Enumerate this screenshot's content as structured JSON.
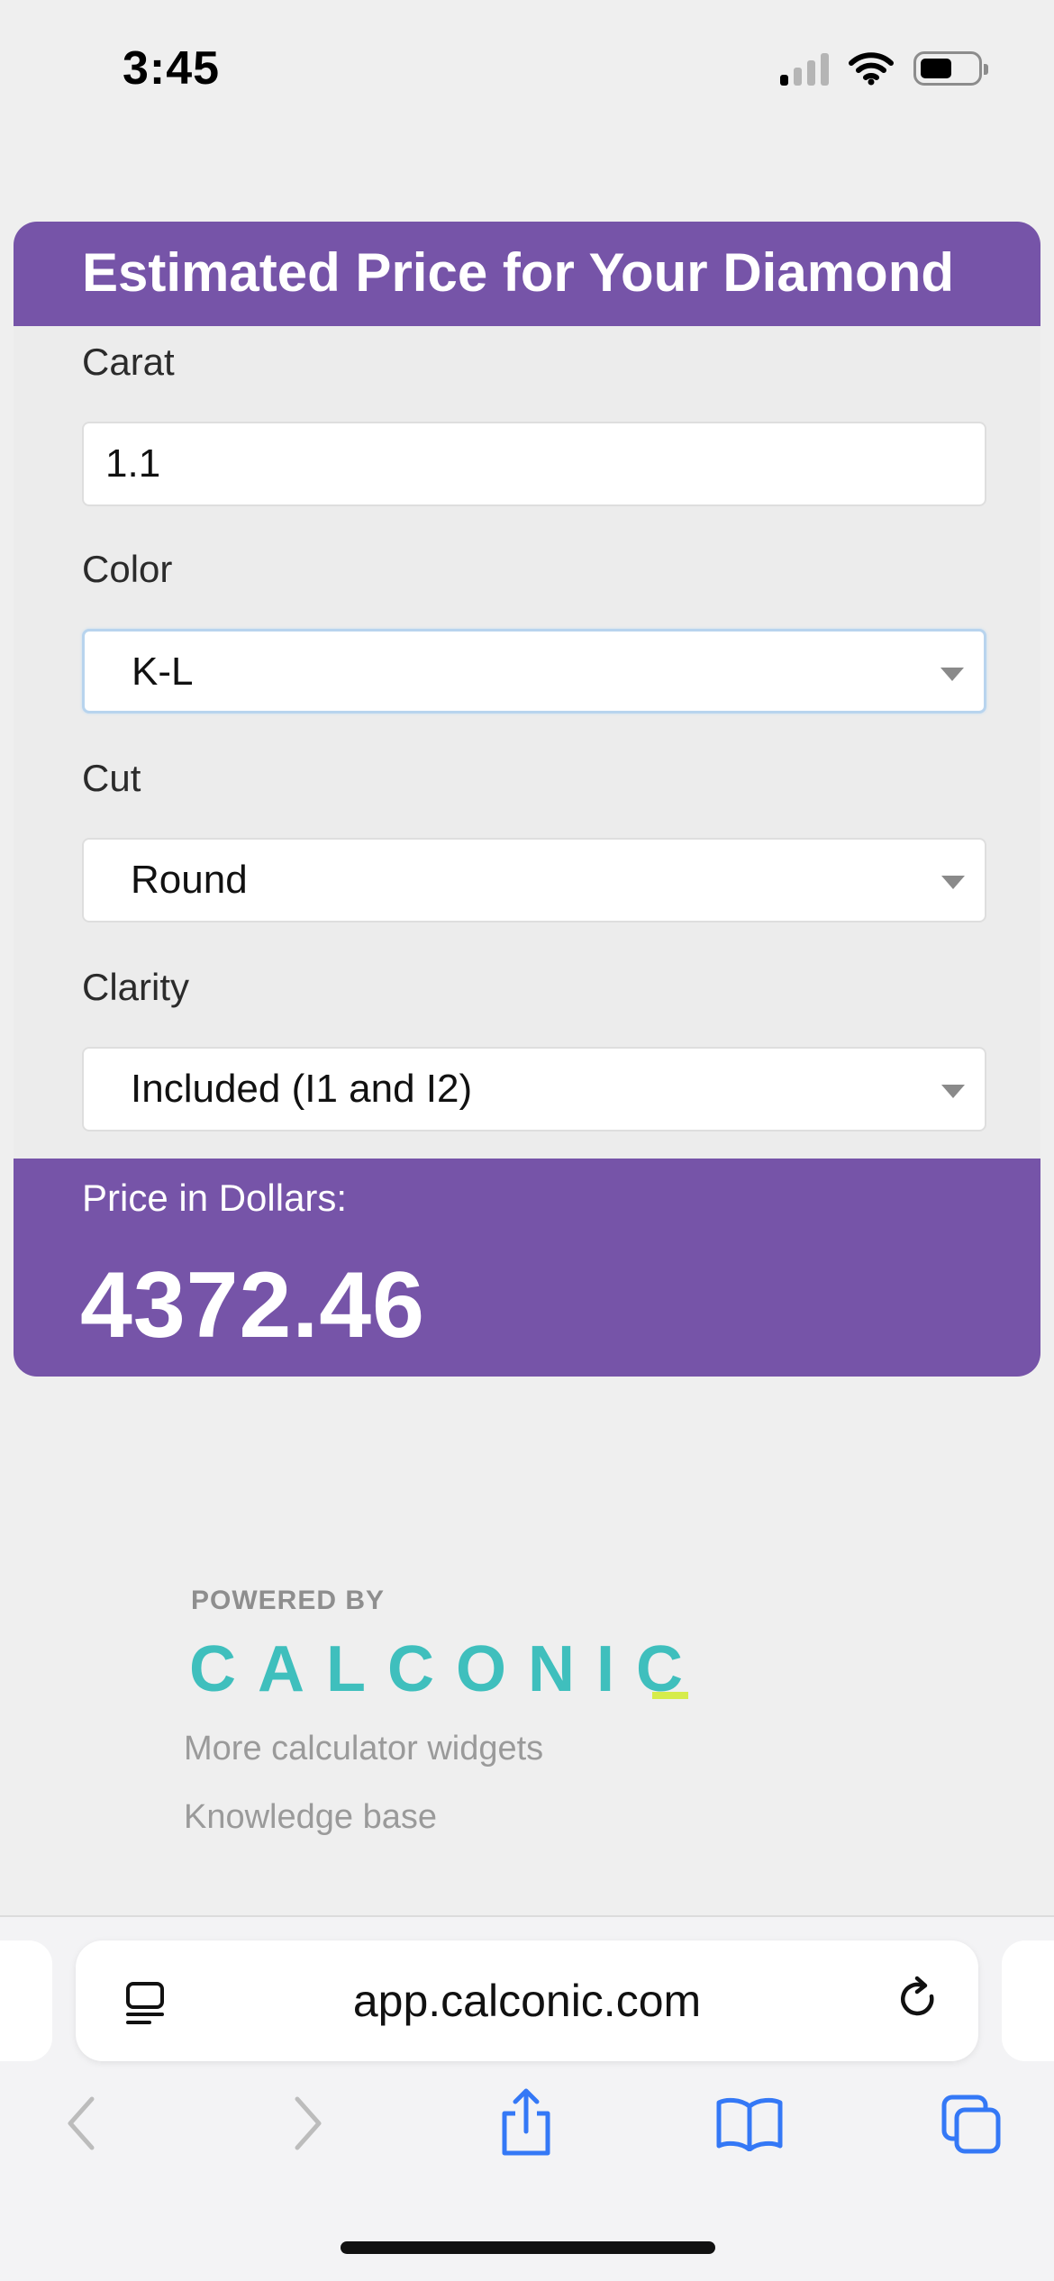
{
  "status_bar": {
    "time": "3:45",
    "icons": [
      "signal-icon",
      "wifi-icon",
      "battery-icon"
    ]
  },
  "calculator": {
    "title": "Estimated Price for Your Diamond",
    "fields": {
      "carat": {
        "label": "Carat",
        "value": "1.1"
      },
      "color": {
        "label": "Color",
        "value": "K-L"
      },
      "cut": {
        "label": "Cut",
        "value": "Round"
      },
      "clarity": {
        "label": "Clarity",
        "value": "Included (I1 and I2)"
      }
    },
    "result": {
      "label": "Price in Dollars:",
      "value": "4372.46"
    },
    "accent_color": "#7654a8"
  },
  "powered_by": {
    "label": "POWERED BY",
    "brand": "CALCONIC",
    "brand_color": "#3fbfbd",
    "links": [
      "More calculator widgets",
      "Knowledge base"
    ]
  },
  "browser": {
    "url": "app.calconic.com",
    "icons": [
      "page-menu-icon",
      "reload-icon",
      "back-icon",
      "forward-icon",
      "share-icon",
      "bookmarks-icon",
      "tabs-icon"
    ],
    "icon_color": "#3478f6"
  }
}
